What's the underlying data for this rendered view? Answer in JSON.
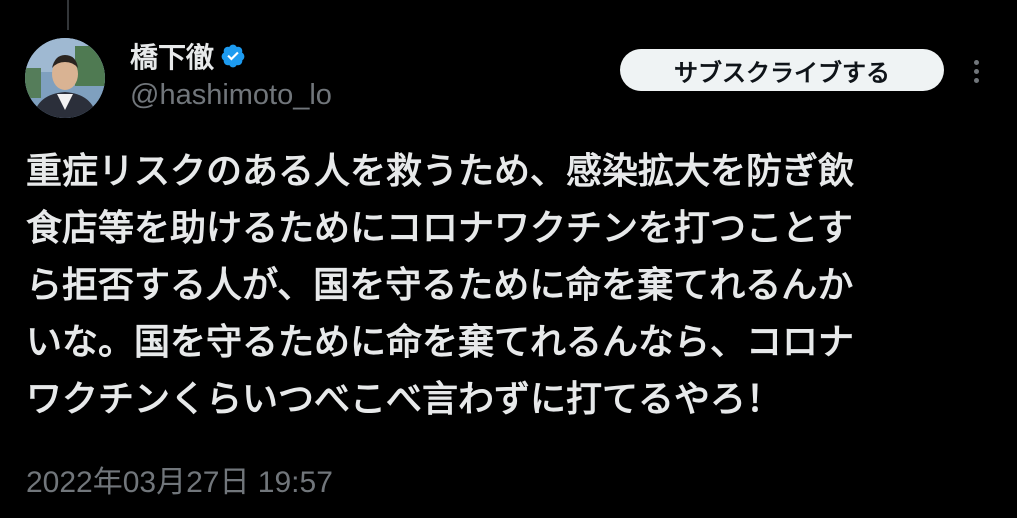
{
  "author": {
    "display_name": "橋下徹",
    "handle": "@hashimoto_lo",
    "verified": true,
    "verified_color": "#1d9bf0"
  },
  "actions": {
    "subscribe_label": "サブスクライブする",
    "more_icon": "more-vertical-icon"
  },
  "tweet": {
    "lines": [
      "重症リスクのある人を救うため、感染拡大を防ぎ飲",
      "食店等を助けるためにコロナワクチンを打つことす",
      "ら拒否する人が、国を守るために命を棄てれるんか",
      "いな。国を守るために命を棄てれるんなら、コロナ",
      "ワクチンくらいつべこべ言わずに打てるやろ！"
    ],
    "timestamp": "2022年03月27日 19:57"
  },
  "colors": {
    "background": "#000000",
    "text": "#e7e9ea",
    "secondary": "#71767b",
    "button_bg": "#eff3f4"
  }
}
